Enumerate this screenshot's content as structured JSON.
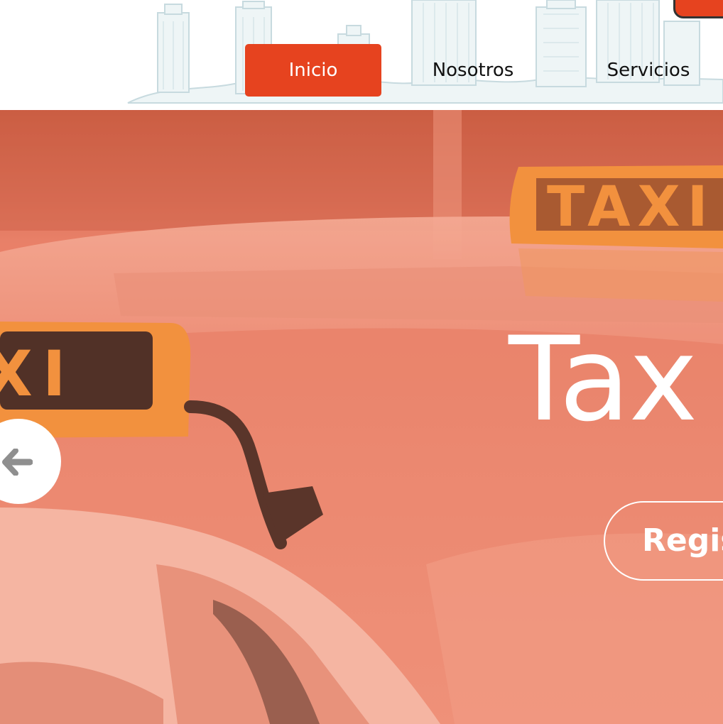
{
  "nav": {
    "items": [
      {
        "label": "Inicio",
        "active": true
      },
      {
        "label": "Nosotros",
        "active": false
      },
      {
        "label": "Servicios",
        "active": false
      }
    ]
  },
  "hero": {
    "title": "Tax",
    "button_label": "Regis",
    "taxi_sign_back": "TAXI",
    "taxi_sign_front": "XI"
  },
  "icons": {
    "prev": "arrow-left-icon",
    "logo": "logo-icon",
    "skyline": "city-skyline-illustration"
  },
  "colors": {
    "accent": "#e6431f",
    "hero_tint": "#ec8f78",
    "taxi_sign": "#f39a3c",
    "nav_text": "#111111",
    "skyline": "#c7dadf"
  }
}
